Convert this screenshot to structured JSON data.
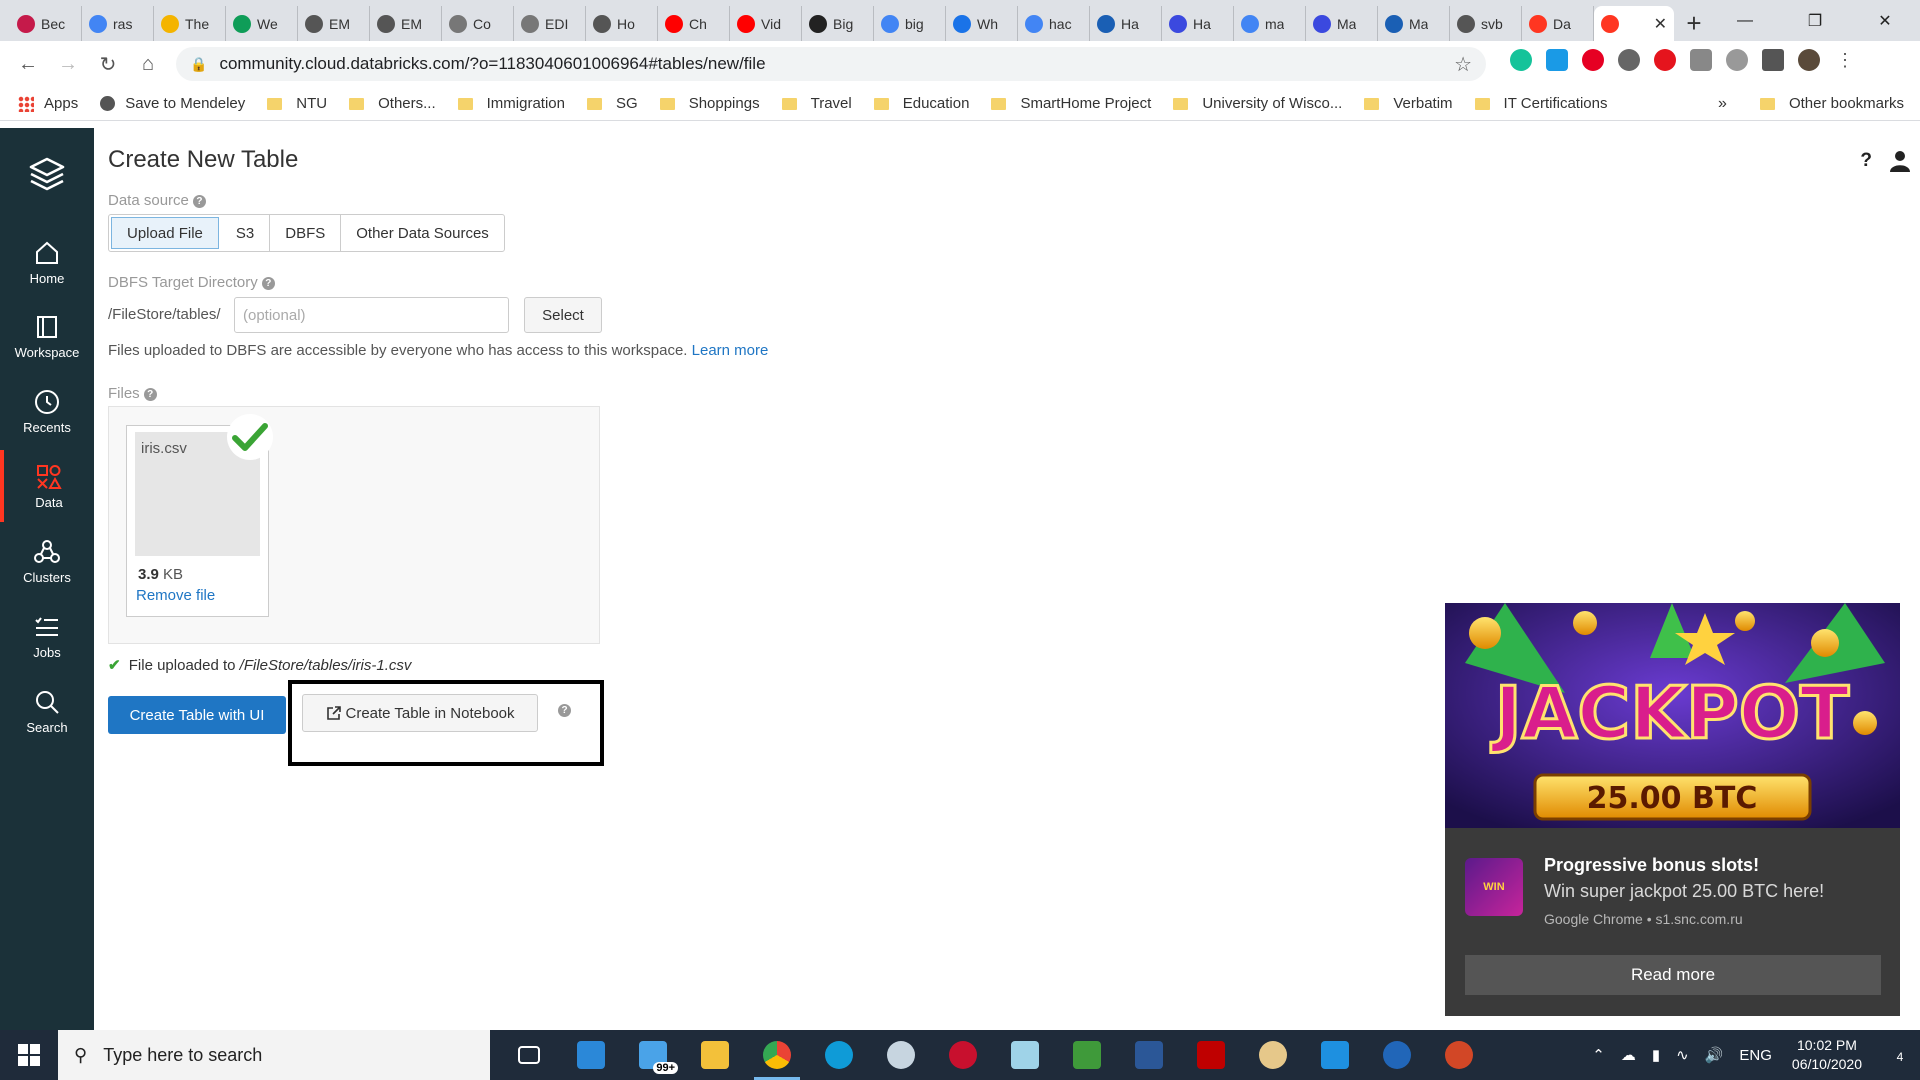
{
  "browser": {
    "tabs": [
      {
        "label": "Bec",
        "icon": "raspberry-icon",
        "color": "#c51a4a"
      },
      {
        "label": "ras",
        "icon": "google-icon",
        "color": "#4285f4"
      },
      {
        "label": "The",
        "icon": "chrome-ext-icon",
        "color": "#f4b400"
      },
      {
        "label": "We",
        "icon": "drive-icon",
        "color": "#0f9d58"
      },
      {
        "label": "EM",
        "icon": "globe-icon",
        "color": "#555555"
      },
      {
        "label": "EM",
        "icon": "globe-icon",
        "color": "#555555"
      },
      {
        "label": "Co",
        "icon": "document-icon",
        "color": "#777777"
      },
      {
        "label": "EDI",
        "icon": "document-icon",
        "color": "#777777"
      },
      {
        "label": "Ho",
        "icon": "globe-icon",
        "color": "#555555"
      },
      {
        "label": "Ch",
        "icon": "youtube-icon",
        "color": "#ff0000"
      },
      {
        "label": "Vid",
        "icon": "youtube-icon",
        "color": "#ff0000"
      },
      {
        "label": "Big",
        "icon": "wikipedia-icon",
        "color": "#222222"
      },
      {
        "label": "big",
        "icon": "google-icon",
        "color": "#4285f4"
      },
      {
        "label": "Wh",
        "icon": "shield-icon",
        "color": "#1a73e8"
      },
      {
        "label": "hac",
        "icon": "google-icon",
        "color": "#4285f4"
      },
      {
        "label": "Ha",
        "icon": "e-icon",
        "color": "#1a5fb4"
      },
      {
        "label": "Ha",
        "icon": "devto-icon",
        "color": "#3b49df"
      },
      {
        "label": "ma",
        "icon": "google-icon",
        "color": "#4285f4"
      },
      {
        "label": "Ma",
        "icon": "devto-icon",
        "color": "#3b49df"
      },
      {
        "label": "Ma",
        "icon": "e-icon",
        "color": "#1a5fb4"
      },
      {
        "label": "svb",
        "icon": "globe-icon",
        "color": "#555555"
      },
      {
        "label": "Da",
        "icon": "databricks-icon",
        "color": "#ff3621"
      }
    ],
    "active_tab_icon": "databricks-icon",
    "new_tab": "+",
    "url": "community.cloud.databricks.com/?o=1183040601006964#tables/new/file",
    "bookmarks": {
      "apps": "Apps",
      "items": [
        "Save to Mendeley",
        "NTU",
        "Others...",
        "Immigration",
        "SG",
        "Shoppings",
        "Travel",
        "Education",
        "SmartHome Project",
        "University of Wisco...",
        "Verbatim",
        "IT Certifications"
      ],
      "more": "»",
      "other": "Other bookmarks"
    }
  },
  "sidebar": {
    "items": [
      {
        "label": "Home",
        "icon": "home-icon"
      },
      {
        "label": "Workspace",
        "icon": "workspace-icon"
      },
      {
        "label": "Recents",
        "icon": "clock-icon"
      },
      {
        "label": "Data",
        "icon": "data-icon",
        "active": true
      },
      {
        "label": "Clusters",
        "icon": "clusters-icon"
      },
      {
        "label": "Jobs",
        "icon": "jobs-icon"
      },
      {
        "label": "Search",
        "icon": "search-icon"
      }
    ],
    "accent": "#ff3621",
    "background": "#1b3139"
  },
  "main": {
    "title": "Create New Table",
    "data_source_label": "Data source",
    "source_tabs": [
      "Upload File",
      "S3",
      "DBFS",
      "Other Data Sources"
    ],
    "selected_source": "Upload File",
    "dbfs_label": "DBFS Target Directory",
    "dbfs_prefix": "/FileStore/tables/",
    "dbfs_placeholder": "(optional)",
    "select_button": "Select",
    "dbfs_note": "Files uploaded to DBFS are accessible by everyone who has access to this workspace.",
    "learn_more": "Learn more",
    "files_label": "Files",
    "file": {
      "name": "iris.csv",
      "size_value": "3.9",
      "size_unit": "KB",
      "remove": "Remove file"
    },
    "upload_status_prefix": "File uploaded to",
    "upload_status_path": "/FileStore/tables/iris-1.csv",
    "create_ui_button": "Create Table with UI",
    "create_notebook_button": "Create Table in Notebook",
    "primary_color": "#1f76c4"
  },
  "notification": {
    "banner_text": "JACKPOT",
    "banner_amount": "25.00 BTC",
    "title": "Progressive bonus slots!",
    "body": "Win super jackpot 25.00 BTC here!",
    "source": "Google Chrome • s1.snc.com.ru",
    "button": "Read more"
  },
  "taskbar": {
    "search_placeholder": "Type here to search",
    "mail_badge": "99+",
    "language": "ENG",
    "time": "10:02 PM",
    "date": "06/10/2020",
    "notifications": "4"
  }
}
